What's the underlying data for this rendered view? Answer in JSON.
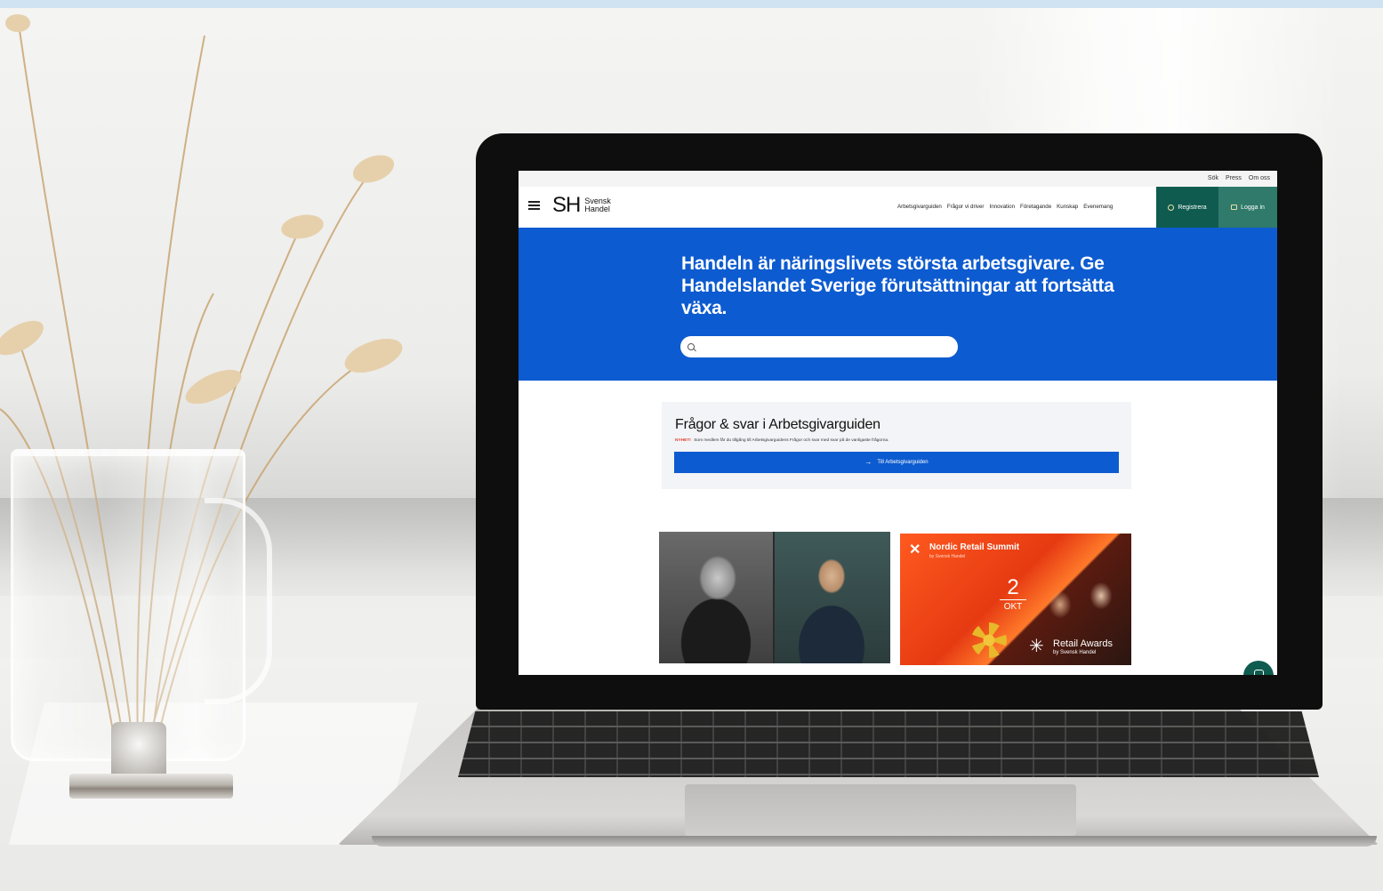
{
  "site": {
    "utility_links": [
      "Sök",
      "Press",
      "Om oss"
    ],
    "logo": {
      "mark": "SH",
      "line1": "Svensk",
      "line2": "Handel"
    },
    "nav": [
      "Arbetsgivarguiden",
      "Frågor vi driver",
      "Innovation",
      "Företagande",
      "Kunskap",
      "Evenemang"
    ],
    "register_label": "Registrera",
    "login_label": "Logga in"
  },
  "hero": {
    "title": "Handeln är näringslivets största arbetsgivare. Ge Handelslandet Sverige förutsättningar att fortsätta växa.",
    "search_placeholder": ""
  },
  "faq": {
    "title": "Frågor & svar i Arbetsgivarguiden",
    "new_badge": "NYHET!",
    "subtitle": "Som medlem får du tillgång till Arbetsgivarguidens Frågor och svar med svar på de vanligaste frågorna.",
    "button_label": "Till Arbetsgivarguiden"
  },
  "promo": {
    "summit_title": "Nordic Retail Summit",
    "summit_sub": "by Svensk Handel",
    "date_day": "2",
    "date_month": "OKT",
    "awards_title": "Retail Awards",
    "awards_sub": "by Svensk Handel"
  },
  "colors": {
    "hero_blue": "#0d5bd0",
    "cta_green": "#0f5b4f",
    "summit_orange": "#ff5a1f"
  }
}
